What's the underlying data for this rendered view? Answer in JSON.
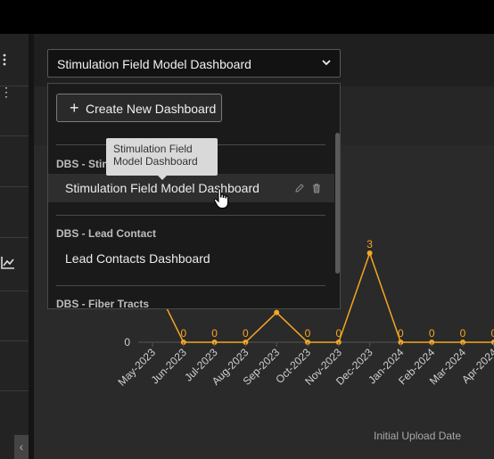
{
  "dashboard_select": {
    "value": "Stimulation Field Model Dashboard"
  },
  "menu": {
    "create_label": "Create New Dashboard",
    "groups": [
      {
        "label": "DBS - Stim",
        "items": [
          "Stimulation Field Model Dashboard"
        ]
      },
      {
        "label": "DBS - Lead Contact",
        "items": [
          "Lead Contacts Dashboard"
        ]
      },
      {
        "label": "DBS - Fiber Tracts",
        "items": []
      }
    ]
  },
  "tooltip": {
    "line1": "Stimulation Field",
    "line2": "Model Dashboard"
  },
  "icons": {
    "select": "chevron-down-icon",
    "create": "plus-icon",
    "edit": "pencil-icon",
    "delete": "trash-icon",
    "sidebar_menu": "kebab-menu-icon",
    "sidebar_chart": "chart-line-icon",
    "collapse": "chevron-left-icon",
    "cursor": "hand-pointer-icon"
  },
  "colors": {
    "series": "#f5a623",
    "background": "#1e1e1e",
    "menu": "#1a1a1a"
  },
  "chart_data": {
    "type": "line",
    "xlabel": "Initial Upload Date",
    "ylabel": "",
    "y_tick_labels": [
      "0"
    ],
    "categories": [
      "May-2023",
      "Jun-2023",
      "Jul-2023",
      "Aug-2023",
      "Sep-2023",
      "Oct-2023",
      "Nov-2023",
      "Dec-2023",
      "Jan-2024",
      "Feb-2024",
      "Mar-2024",
      "Apr-2024"
    ],
    "values": [
      null,
      0,
      0,
      0,
      1,
      0,
      0,
      3,
      0,
      0,
      0,
      0
    ],
    "data_labels": [
      "",
      "0",
      "0",
      "0",
      "",
      "0",
      "0",
      "3",
      "0",
      "0",
      "0",
      "0"
    ],
    "ylim": [
      0,
      3.3
    ],
    "grid": false
  }
}
